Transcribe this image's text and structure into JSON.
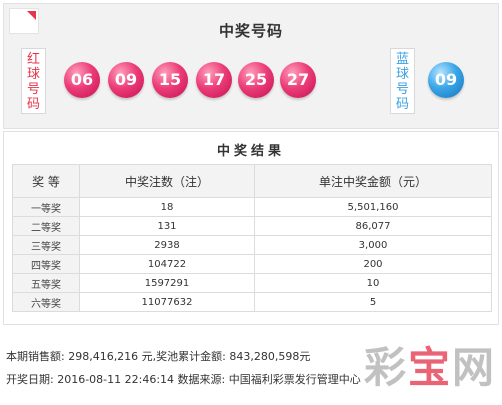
{
  "draw": {
    "title": "中奖号码",
    "red_label": [
      "红",
      "球",
      "号",
      "码"
    ],
    "blue_label": [
      "蓝",
      "球",
      "号",
      "码"
    ],
    "red_balls": [
      "06",
      "09",
      "15",
      "17",
      "25",
      "27"
    ],
    "blue_balls": [
      "09"
    ],
    "colors": {
      "red_ball": "#e8346f",
      "blue_ball": "#2f93d8",
      "red_text": "#e8344b",
      "blue_text": "#3aa0e0"
    }
  },
  "results": {
    "title": "中奖结果",
    "headers": [
      "奖 等",
      "中奖注数（注）",
      "单注中奖金额（元）"
    ],
    "rows": [
      {
        "level": "一等奖",
        "count": "18",
        "amount": "5,501,160"
      },
      {
        "level": "二等奖",
        "count": "131",
        "amount": "86,077"
      },
      {
        "level": "三等奖",
        "count": "2938",
        "amount": "3,000"
      },
      {
        "level": "四等奖",
        "count": "104722",
        "amount": "200"
      },
      {
        "level": "五等奖",
        "count": "1597291",
        "amount": "10"
      },
      {
        "level": "六等奖",
        "count": "11077632",
        "amount": "5"
      }
    ]
  },
  "footer": {
    "line1": "本期销售额: 298,416,216 元,奖池累计金额: 843,280,598元",
    "line2": "开奖日期: 2016-08-11 22:46:14 数据来源: 中国福利彩票发行管理中心"
  },
  "watermark": {
    "chars": [
      "彩",
      "宝",
      "网"
    ]
  }
}
